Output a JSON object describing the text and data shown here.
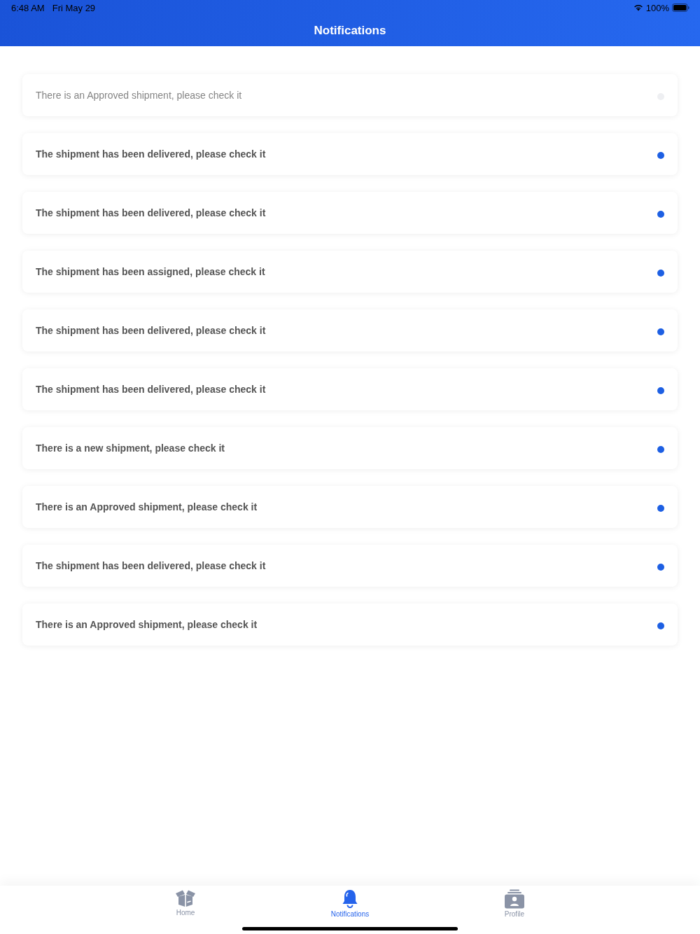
{
  "status_bar": {
    "time": "6:48 AM",
    "date": "Fri May 29",
    "battery": "100%"
  },
  "nav_bar": {
    "title": "Notifications"
  },
  "notifications": [
    {
      "text": "There is an Approved shipment, please check it",
      "unread": false
    },
    {
      "text": "The shipment has been delivered, please check it",
      "unread": true
    },
    {
      "text": "The shipment has been delivered, please check it",
      "unread": true
    },
    {
      "text": "The shipment has been assigned, please check it",
      "unread": true
    },
    {
      "text": "The shipment has been delivered, please check it",
      "unread": true
    },
    {
      "text": "The shipment has been delivered, please check it",
      "unread": true
    },
    {
      "text": "There is a new shipment, please check it",
      "unread": true
    },
    {
      "text": "There is an Approved shipment, please check it",
      "unread": true
    },
    {
      "text": "The shipment has been delivered, please check it",
      "unread": true
    },
    {
      "text": "There is an Approved shipment, please check it",
      "unread": true
    }
  ],
  "tab_bar": {
    "tabs": [
      {
        "label": "Home",
        "selected": false
      },
      {
        "label": "Notifications",
        "selected": true
      },
      {
        "label": "Profile",
        "selected": false
      }
    ]
  }
}
